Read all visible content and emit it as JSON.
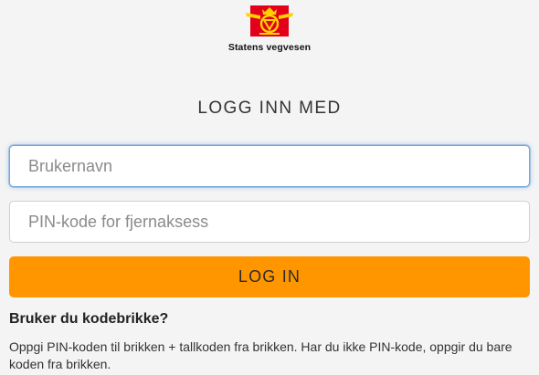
{
  "brand": {
    "name": "Statens vegvesen",
    "logo_icon": "statens-vegvesen-emblem",
    "logo_colors": {
      "red": "#e2001a",
      "yellow": "#ffd200"
    }
  },
  "login": {
    "heading": "LOGG INN MED",
    "username_placeholder": "Brukernavn",
    "username_value": "",
    "pin_placeholder": "PIN-kode for fjernaksess",
    "pin_value": "",
    "submit_label": "LOG IN",
    "accent_color": "#ff9600",
    "focus_color": "#74a5dd"
  },
  "help": {
    "title": "Bruker du kodebrikke?",
    "text": "Oppgi PIN-koden til brikken + tallkoden fra brikken. Har du ikke PIN-kode, oppgir du bare koden fra brikken."
  }
}
